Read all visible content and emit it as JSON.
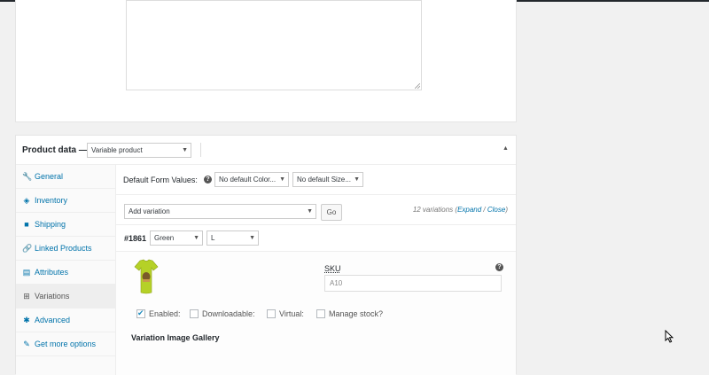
{
  "product_data": {
    "title": "Product data —",
    "type_select": "Variable product",
    "collapse_icon": "triangle-up-icon"
  },
  "tabs": [
    {
      "label": "General",
      "icon": "wrench-icon",
      "glyph": "🔧"
    },
    {
      "label": "Inventory",
      "icon": "tag-icon",
      "glyph": "◈"
    },
    {
      "label": "Shipping",
      "icon": "truck-icon",
      "glyph": "■"
    },
    {
      "label": "Linked Products",
      "icon": "link-icon",
      "glyph": "🔗"
    },
    {
      "label": "Attributes",
      "icon": "list-icon",
      "glyph": "▤"
    },
    {
      "label": "Variations",
      "icon": "grid-icon",
      "glyph": "⊞"
    },
    {
      "label": "Advanced",
      "icon": "gear-icon",
      "glyph": "✱"
    },
    {
      "label": "Get more options",
      "icon": "plugin-icon",
      "glyph": "✎"
    }
  ],
  "variations": {
    "default_form_label": "Default Form Values:",
    "default_color": "No default Color...",
    "default_size": "No default Size...",
    "add_variation": "Add variation",
    "go_button": "Go",
    "count": "12 variations",
    "expand": "Expand",
    "slash": " / ",
    "close": "Close",
    "variation_id": "#1861",
    "color_value": "Green",
    "size_value": "L",
    "sku_label": "SKU",
    "sku_placeholder": "A10",
    "enabled": "Enabled:",
    "downloadable": "Downloadable:",
    "virtual": "Virtual:",
    "manage_stock": "Manage stock?",
    "enabled_checked": true,
    "gallery_title": "Variation Image Gallery"
  },
  "colors": {
    "link": "#0073aa",
    "tshirt": "#b5d127"
  }
}
